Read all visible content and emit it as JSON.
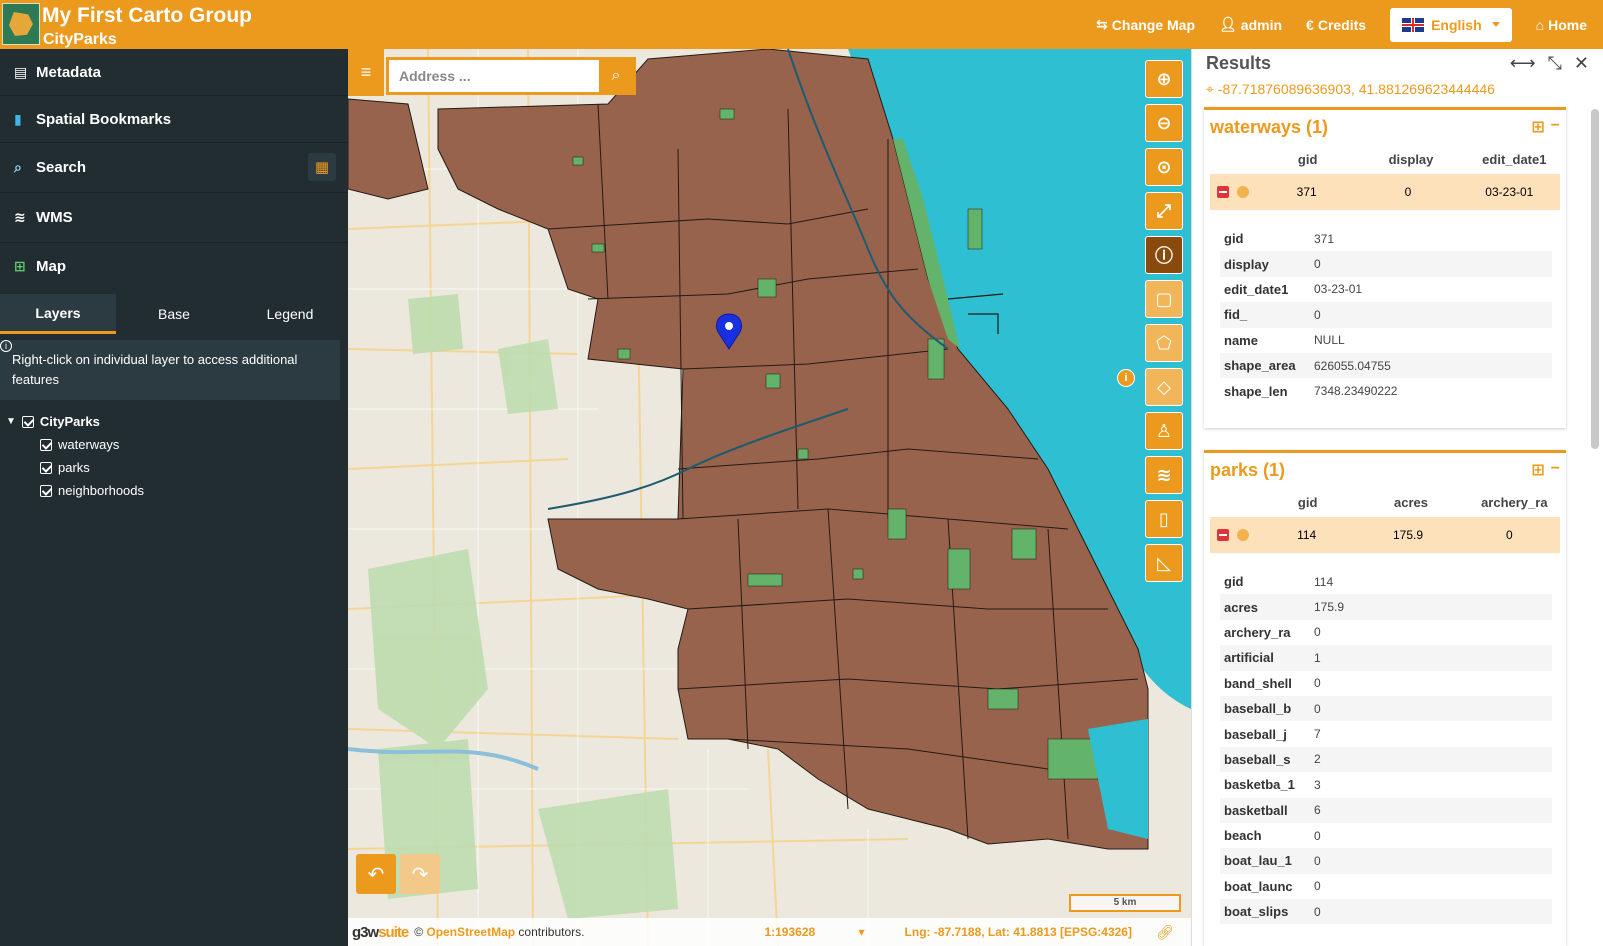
{
  "header": {
    "title": "My First Carto Group",
    "subtitle": "CityParks",
    "nav": [
      {
        "icon": "signpost-icon",
        "label": "Change Map"
      },
      {
        "icon": "user-icon",
        "label": "admin"
      },
      {
        "icon": "euro-icon",
        "label": "Credits"
      }
    ],
    "language": "English",
    "home_label": "Home"
  },
  "sidebar": {
    "items": [
      {
        "icon": "file-icon",
        "label": "Metadata"
      },
      {
        "icon": "bookmark-icon",
        "label": "Spatial Bookmarks"
      },
      {
        "icon": "search-icon",
        "label": "Search"
      },
      {
        "icon": "layers-icon",
        "label": "WMS"
      },
      {
        "icon": "map-icon",
        "label": "Map"
      }
    ],
    "tabs": [
      "Layers",
      "Base",
      "Legend"
    ],
    "active_tab": "Layers",
    "info_text": "Right-click on individual layer to access additional features",
    "tree": {
      "group": "CityParks",
      "layers": [
        "waterways",
        "parks",
        "neighborhoods"
      ]
    }
  },
  "map": {
    "search_placeholder": "Address ...",
    "scale_text": "5 km",
    "scale_select": "1:193628",
    "coordinates": "Lng: -87.7188, Lat: 41.8813  [EPSG:4326]",
    "attribution_prefix": "©",
    "attribution_link": "OpenStreetMap",
    "attribution_suffix": "contributors.",
    "brand": "g3wsuite",
    "tools": [
      "zoom-in-icon",
      "zoom-out-icon",
      "zoom-extent-icon",
      "fullscreen-icon",
      "query-icon",
      "query-bbox-icon",
      "query-polygon-icon",
      "query-draw-icon",
      "streetview-icon",
      "add-layer-icon",
      "ruler-icon",
      "area-measure-icon"
    ]
  },
  "results": {
    "title": "Results",
    "location": "-87.71876089636903, 41.881269623444446",
    "layers": [
      {
        "name": "waterways (1)",
        "columns": [
          "gid",
          "display",
          "edit_date1"
        ],
        "row": [
          "371",
          "0",
          "03-23-01"
        ],
        "attributes": [
          {
            "k": "gid",
            "v": "371"
          },
          {
            "k": "display",
            "v": "0"
          },
          {
            "k": "edit_date1",
            "v": "03-23-01"
          },
          {
            "k": "fid_",
            "v": "0"
          },
          {
            "k": "name",
            "v": "NULL"
          },
          {
            "k": "shape_area",
            "v": "626055.04755"
          },
          {
            "k": "shape_len",
            "v": "7348.23490222"
          }
        ]
      },
      {
        "name": "parks (1)",
        "columns": [
          "gid",
          "acres",
          "archery_ra"
        ],
        "row": [
          "114",
          "175.9",
          "0"
        ],
        "attributes": [
          {
            "k": "gid",
            "v": "114"
          },
          {
            "k": "acres",
            "v": "175.9"
          },
          {
            "k": "archery_ra",
            "v": "0"
          },
          {
            "k": "artificial",
            "v": "1"
          },
          {
            "k": "band_shell",
            "v": "0"
          },
          {
            "k": "baseball_b",
            "v": "0"
          },
          {
            "k": "baseball_j",
            "v": "7"
          },
          {
            "k": "baseball_s",
            "v": "2"
          },
          {
            "k": "basketba_1",
            "v": "3"
          },
          {
            "k": "basketball",
            "v": "6"
          },
          {
            "k": "beach",
            "v": "0"
          },
          {
            "k": "boat_lau_1",
            "v": "0"
          },
          {
            "k": "boat_launc",
            "v": "0"
          },
          {
            "k": "boat_slips",
            "v": "0"
          }
        ]
      }
    ]
  },
  "colors": {
    "accent": "#ec9a1e",
    "sidebar": "#222d32",
    "lake": "#2fbfd3",
    "neighborhood": "#98634c",
    "park": "#63b36b"
  }
}
